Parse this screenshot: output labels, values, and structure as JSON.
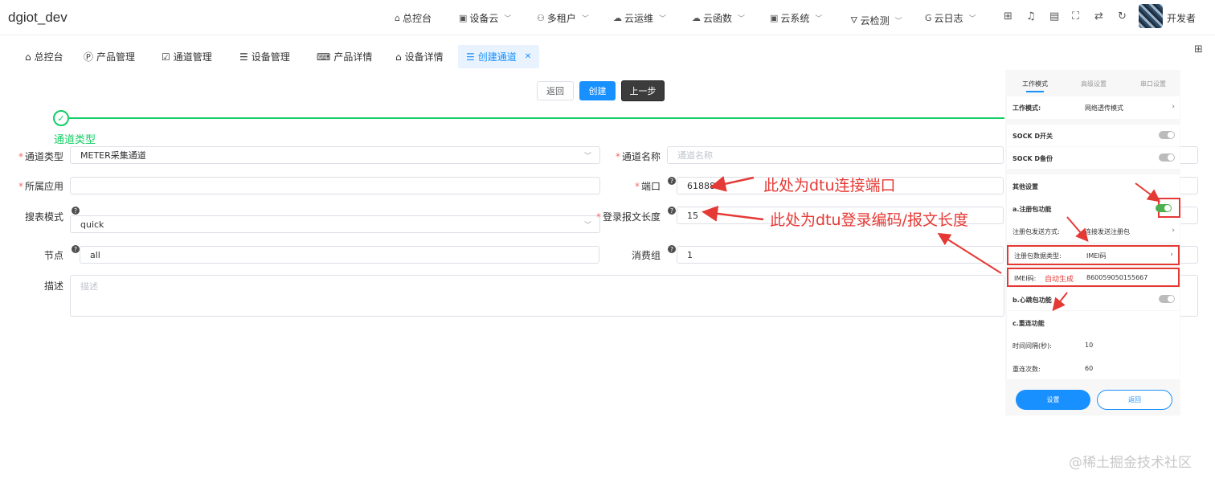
{
  "app_title": "dgiot_dev",
  "nav": {
    "items": [
      {
        "label": "总控台",
        "icon": "home-icon",
        "dropdown": false
      },
      {
        "label": "设备云",
        "icon": "device-icon",
        "dropdown": true
      },
      {
        "label": "多租户",
        "icon": "users-icon",
        "dropdown": true
      },
      {
        "label": "云运维",
        "icon": "cloud-icon",
        "dropdown": true
      },
      {
        "label": "云函数",
        "icon": "cloud-function-icon",
        "dropdown": true
      },
      {
        "label": "云系统",
        "icon": "system-icon",
        "dropdown": true
      },
      {
        "label": "云检测",
        "icon": "test-tube-icon",
        "dropdown": true
      },
      {
        "label": "云日志",
        "icon": "log-icon",
        "dropdown": true
      }
    ],
    "user_label": "开发者"
  },
  "tabs": [
    {
      "label": "总控台",
      "icon": "home-icon"
    },
    {
      "label": "产品管理",
      "icon": "product-icon"
    },
    {
      "label": "通道管理",
      "icon": "channel-icon"
    },
    {
      "label": "设备管理",
      "icon": "device-list-icon"
    },
    {
      "label": "产品详情",
      "icon": "code-icon"
    },
    {
      "label": "设备详情",
      "icon": "home-icon"
    },
    {
      "label": "创建通道",
      "icon": "list-icon",
      "active": true,
      "closable": true
    }
  ],
  "actions": {
    "back": "返回",
    "create": "创建",
    "prev": "上一步"
  },
  "step": {
    "label": "通道类型"
  },
  "form": {
    "channel_type": {
      "label": "通道类型",
      "value": "METER采集通道",
      "required": true
    },
    "channel_name": {
      "label": "通道名称",
      "placeholder": "通道名称",
      "required": true
    },
    "app": {
      "label": "所属应用",
      "value": "",
      "required": true
    },
    "port": {
      "label": "端口",
      "value": "61888",
      "required": true
    },
    "search_mode": {
      "label": "搜表模式",
      "value": "quick"
    },
    "login_len": {
      "label": "登录报文长度",
      "value": "15",
      "required": true
    },
    "node": {
      "label": "节点",
      "value": "all"
    },
    "consumer_group": {
      "label": "消费组",
      "value": "1"
    },
    "desc": {
      "label": "描述",
      "placeholder": "描述"
    }
  },
  "annotations": {
    "port_note": "此处为dtu连接端口",
    "login_note": "此处为dtu登录编码/报文长度",
    "imei_auto": "自动生成"
  },
  "panel": {
    "tabs": [
      "工作模式",
      "高级设置",
      "串口设置"
    ],
    "work_mode": {
      "label": "工作模式:",
      "value": "网络透传模式"
    },
    "sockd_switch": {
      "label": "SOCK D开关",
      "on": false
    },
    "sockd_backup": {
      "label": "SOCK D备份",
      "on": false
    },
    "other_settings": "其他设置",
    "register_pkg": {
      "label": "a.注册包功能",
      "on": true
    },
    "register_send": {
      "label": "注册包发送方式:",
      "value": "连接发送注册包"
    },
    "register_type": {
      "label": "注册包数据类型:",
      "value": "IMEI码"
    },
    "imei": {
      "label": "IMEI码:",
      "value": "860059050155667"
    },
    "heartbeat": {
      "label": "b.心跳包功能",
      "on": false
    },
    "reconnect": "c.重连功能",
    "interval": {
      "label": "时间间隔(秒):",
      "value": "10"
    },
    "retries": {
      "label": "重连次数:",
      "value": "60"
    },
    "btn_set": "设置",
    "btn_return": "返回"
  },
  "watermark": "@稀土掘金技术社区"
}
